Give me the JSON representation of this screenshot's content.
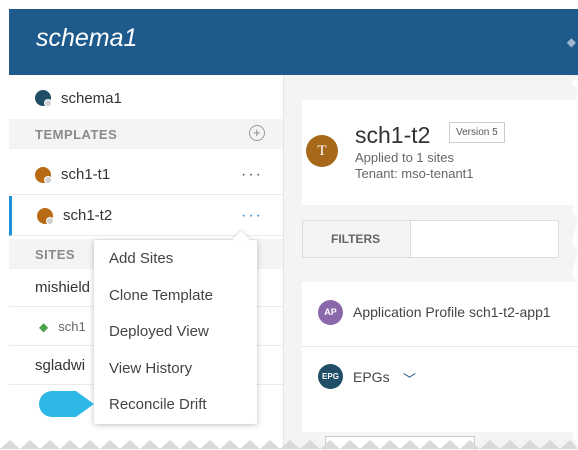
{
  "header": {
    "title": "schema1"
  },
  "sidebar": {
    "schema": {
      "label": "schema1",
      "icon": "schema-icon"
    },
    "templates_section": {
      "label": "TEMPLATES",
      "add_icon": "add-circle-icon"
    },
    "templates": [
      {
        "label": "sch1-t1",
        "more": "···"
      },
      {
        "label": "sch1-t2",
        "more": "···",
        "selected": true
      }
    ],
    "sites_section": {
      "label": "SITES"
    },
    "sites": [
      {
        "label": "mishield"
      },
      {
        "label": "sch1"
      },
      {
        "label": "sgladwi"
      }
    ]
  },
  "context_menu": {
    "items": [
      "Add Sites",
      "Clone Template",
      "Deployed View",
      "View History",
      "Reconcile Drift"
    ]
  },
  "template_card": {
    "avatar": "T",
    "name": "sch1-t2",
    "version": "Version 5",
    "applied": "Applied to 1 sites",
    "tenant": "Tenant: mso-tenant1"
  },
  "filters": {
    "label": "FILTERS"
  },
  "app_profile": {
    "icon_text": "AP",
    "label": "Application Profile sch1-t2-app1"
  },
  "epgs": {
    "icon_text": "EPG",
    "label": "EPGs"
  },
  "colors": {
    "header": "#1f5a8c",
    "accent": "#1f8fd6",
    "callout": "#2eb8e6"
  }
}
